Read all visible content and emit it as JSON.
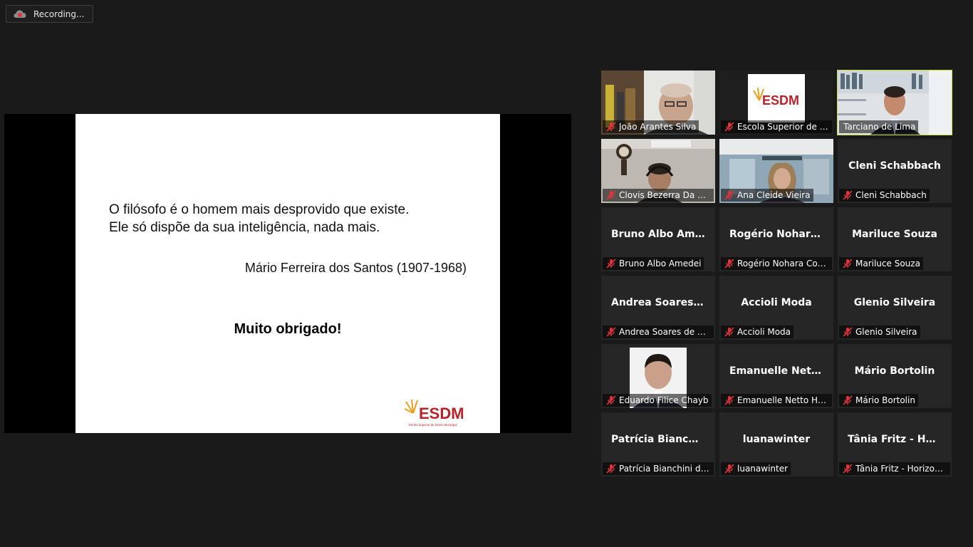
{
  "recording": {
    "label": "Recording..."
  },
  "slide": {
    "quote_line1": "O filósofo é o homem mais desprovido que existe.",
    "quote_line2": "Ele só dispõe da sua inteligência, nada mais.",
    "author": "Mário Ferreira dos Santos (1907-1968)",
    "thanks": "Muito obrigado!",
    "logo_text": "ESDM",
    "logo_sub": "Escola Superior de Direito Municipal"
  },
  "participants": [
    {
      "name": "João Arantes Silva",
      "video": "man-glasses-bookshelf",
      "muted": true
    },
    {
      "name": "Escola Superior de Di...",
      "video": "esdm-logo",
      "muted": true
    },
    {
      "name": "Tarciano de Lima",
      "video": "man-suit-bookshelf",
      "muted": false,
      "active": true
    },
    {
      "name": "Clovis Bezerra Da Silva",
      "video": "man-headset-clock",
      "muted": true
    },
    {
      "name": "Ana Cleide Vieira",
      "video": "woman-window",
      "muted": true
    },
    {
      "name": "Cleni Schabbach",
      "display": "Cleni Schabbach",
      "muted": true
    },
    {
      "name": "Bruno Albo Amedei",
      "display": "Bruno Albo Am...",
      "muted": true
    },
    {
      "name": "Rogério Nohara Corr...",
      "display": "Rogério  Nohara...",
      "muted": true
    },
    {
      "name": "Mariluce Souza",
      "display": "Mariluce Souza",
      "muted": true
    },
    {
      "name": "Andrea Soares de Ca...",
      "display": "Andrea Soares d...",
      "muted": true
    },
    {
      "name": "Accioli Moda",
      "display": "Accioli Moda",
      "muted": true
    },
    {
      "name": "Glenio Silveira",
      "display": "Glenio Silveira",
      "muted": true
    },
    {
      "name": "Eduardo Filice Chayb",
      "video": "man-portrait-photo",
      "muted": true
    },
    {
      "name": "Emanuelle Netto Her...",
      "display": "Emanuelle  Nett...",
      "muted": true
    },
    {
      "name": "Mário Bortolin",
      "display": "Mário Bortolin",
      "muted": true
    },
    {
      "name": "Patrícia Bianchini de ...",
      "display": "Patrícia  Bianchi...",
      "muted": true
    },
    {
      "name": "luanawinter",
      "display": "luanawinter",
      "muted": true
    },
    {
      "name": "Tânia Fritz - Horizonti...",
      "display": "Tânia Fritz - Hor...",
      "muted": true
    }
  ],
  "colors": {
    "active_speaker": "#c8e33c",
    "mute_red": "#e0353b",
    "background": "#1a1a1a",
    "tile": "#262626"
  }
}
